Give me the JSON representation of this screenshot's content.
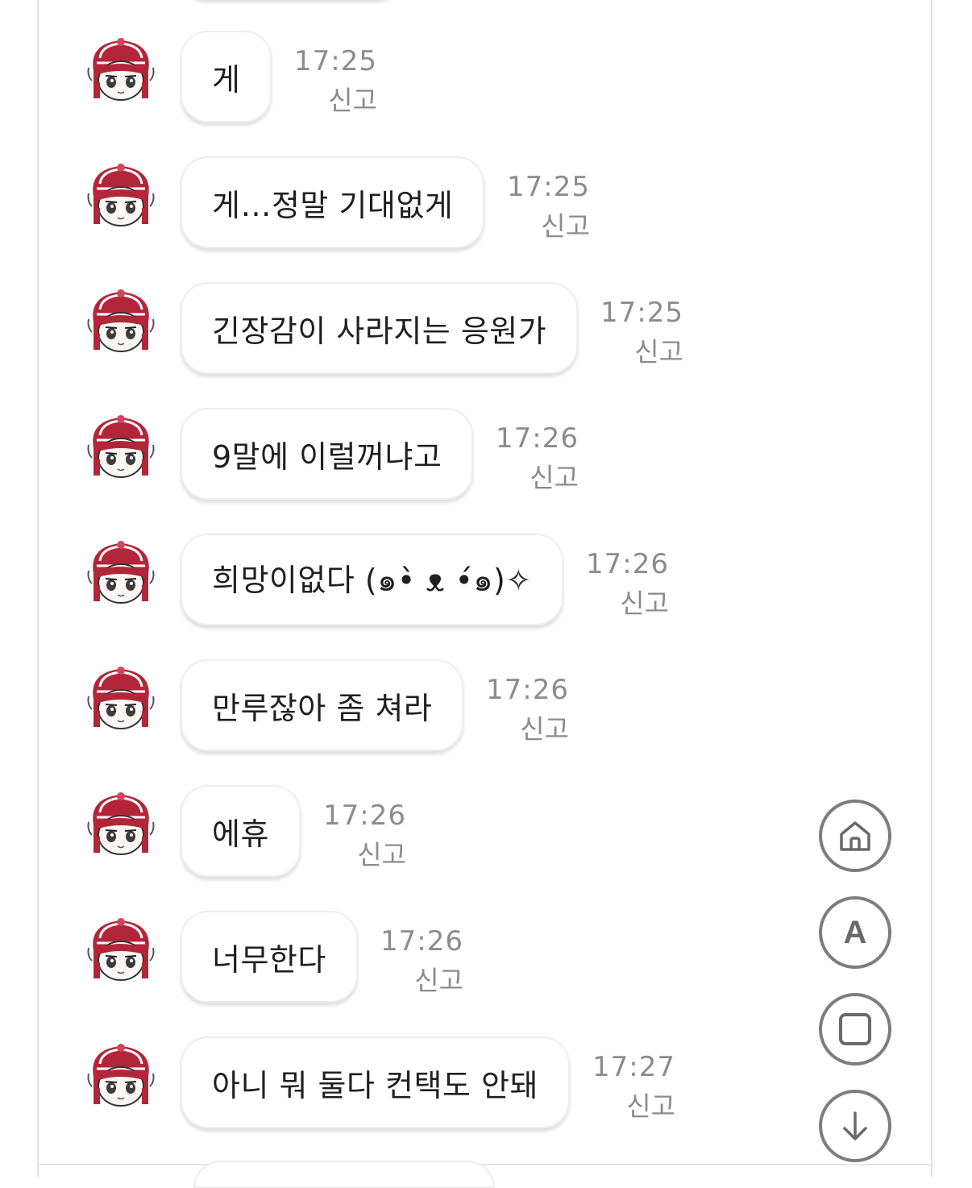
{
  "messages": [
    {
      "text": "게",
      "time": "17:25",
      "report": "신고"
    },
    {
      "text": "게…정말 기대없게",
      "time": "17:25",
      "report": "신고"
    },
    {
      "text": "긴장감이 사라지는 응원가",
      "time": "17:25",
      "report": "신고"
    },
    {
      "text": "9말에 이럴꺼냐고",
      "time": "17:26",
      "report": "신고"
    },
    {
      "text": "희망이없다 (๑•̀ ᴥ •́๑)✧",
      "time": "17:26",
      "report": "신고"
    },
    {
      "text": "만루잖아 좀 쳐라",
      "time": "17:26",
      "report": "신고"
    },
    {
      "text": "에휴",
      "time": "17:26",
      "report": "신고"
    },
    {
      "text": "너무한다",
      "time": "17:26",
      "report": "신고"
    },
    {
      "text": "아니 뭐 둘다 컨택도 안돼",
      "time": "17:27",
      "report": "신고"
    }
  ],
  "floating_buttons": [
    {
      "icon": "home-icon"
    },
    {
      "icon": "font-size-icon",
      "label": "A"
    },
    {
      "icon": "square-icon"
    },
    {
      "icon": "arrow-down-icon"
    }
  ],
  "colors": {
    "avatar_hair": "#b3263a",
    "avatar_hair_light": "#d4455a",
    "timestamp": "#8c8c8c",
    "button_border": "#7d7d7d"
  }
}
